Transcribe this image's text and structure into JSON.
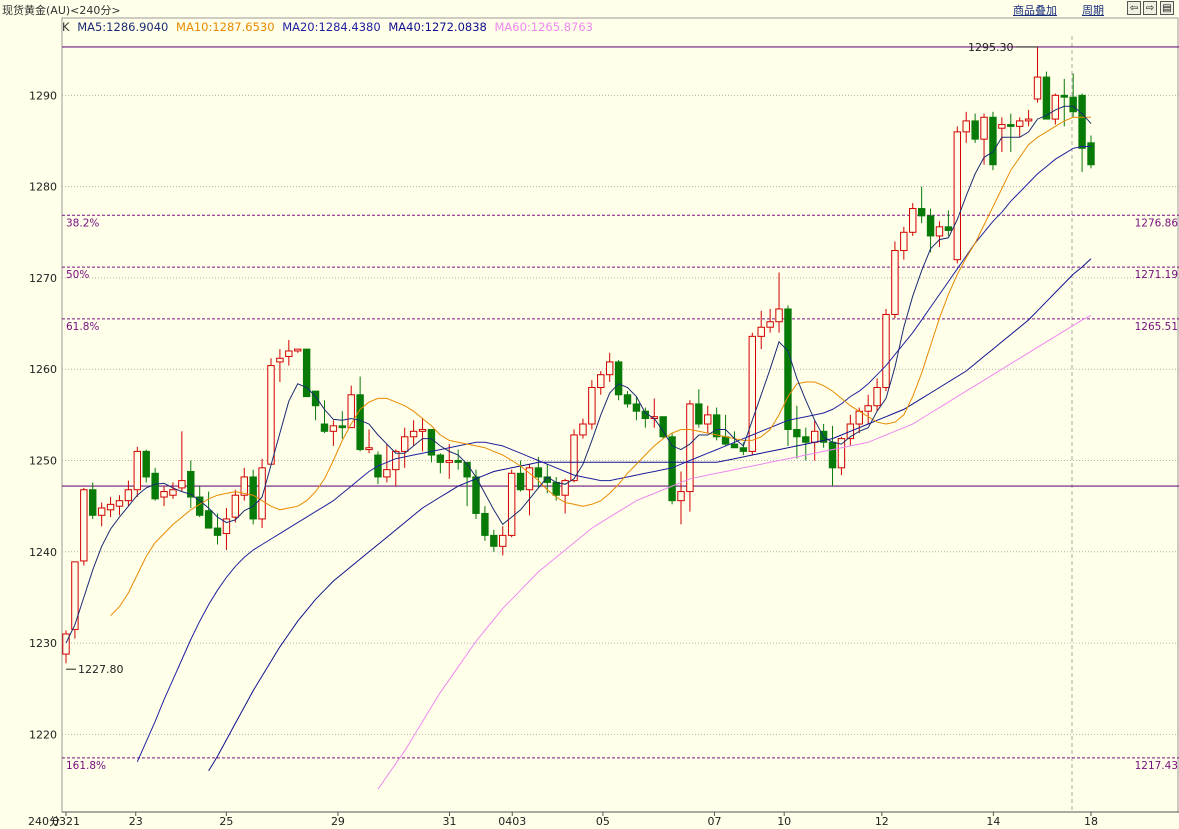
{
  "header": {
    "title": "现货黄金(AU)<240分>",
    "overlay_btn": "商品叠加",
    "period_btn": "周期",
    "nav_prev_icon": "arrow-left-box",
    "nav_next_icon": "arrow-right-box",
    "panel_icon": "panel-layout"
  },
  "ma_legend": {
    "k": "K",
    "ma5": "MA5:1286.9040",
    "ma10": "MA10:1287.6530",
    "ma20": "MA20:1284.4380",
    "ma40": "MA40:1272.0838",
    "ma60": "MA60:1265.8763"
  },
  "colors": {
    "up": "#d20000",
    "down": "#087a08",
    "ma5": "#1a2b72",
    "ma10": "#e88a00",
    "ma20": "#2020a0",
    "ma40": "#101090",
    "ma60": "#ee88ee",
    "fib": "#7a1080",
    "bg": "#ffffea",
    "grid": "#b0b0b0"
  },
  "chart_data": {
    "type": "candlestick",
    "period_label": "240分",
    "x_tick_labels": [
      "0321",
      "23",
      "25",
      "29",
      "31",
      "0403",
      "05",
      "07",
      "10",
      "12",
      "14",
      "18"
    ],
    "y_ticks": [
      1220,
      1230,
      1240,
      1250,
      1260,
      1270,
      1280,
      1290
    ],
    "ylim": [
      1211.5,
      1296.5
    ],
    "max_label": "1295.30",
    "min_label": "1227.80",
    "fib_levels": [
      {
        "pct": "38.2%",
        "value": "1276.86"
      },
      {
        "pct": "50%",
        "value": "1271.19"
      },
      {
        "pct": "61.8%",
        "value": "1265.51"
      },
      {
        "pct": "161.8%",
        "value": "1217.43"
      }
    ],
    "hlines": [
      1295.3,
      1247.2
    ],
    "candles": [
      [
        1228.8,
        1231.4,
        1227.8,
        1231.0
      ],
      [
        1231.5,
        1238.9,
        1230.5,
        1238.9
      ],
      [
        1239.0,
        1247.0,
        1238.5,
        1246.8
      ],
      [
        1246.8,
        1247.6,
        1243.6,
        1244.0
      ],
      [
        1244.0,
        1245.4,
        1242.8,
        1244.8
      ],
      [
        1244.6,
        1246.0,
        1243.8,
        1245.2
      ],
      [
        1245.0,
        1246.2,
        1244.0,
        1245.6
      ],
      [
        1245.6,
        1247.8,
        1245.0,
        1246.8
      ],
      [
        1246.8,
        1251.5,
        1246.0,
        1251.0
      ],
      [
        1251.0,
        1251.2,
        1247.6,
        1248.2
      ],
      [
        1248.6,
        1249.2,
        1245.6,
        1245.8
      ],
      [
        1246.0,
        1247.2,
        1245.0,
        1246.6
      ],
      [
        1246.2,
        1247.6,
        1245.8,
        1246.8
      ],
      [
        1247.0,
        1253.2,
        1246.6,
        1247.8
      ],
      [
        1248.8,
        1250.0,
        1244.8,
        1246.0
      ],
      [
        1246.0,
        1247.2,
        1243.8,
        1244.0
      ],
      [
        1244.5,
        1246.6,
        1243.0,
        1242.6
      ],
      [
        1242.6,
        1244.2,
        1240.8,
        1241.8
      ],
      [
        1242.0,
        1244.8,
        1240.2,
        1243.6
      ],
      [
        1243.8,
        1246.8,
        1243.2,
        1246.2
      ],
      [
        1246.2,
        1249.2,
        1245.6,
        1248.2
      ],
      [
        1248.2,
        1249.0,
        1243.0,
        1243.6
      ],
      [
        1243.6,
        1250.2,
        1242.6,
        1249.2
      ],
      [
        1249.6,
        1261.2,
        1249.6,
        1260.4
      ],
      [
        1260.8,
        1262.2,
        1258.6,
        1261.2
      ],
      [
        1261.4,
        1263.2,
        1260.4,
        1262.0
      ],
      [
        1262.0,
        1261.0,
        1261.8,
        1262.2
      ],
      [
        1262.2,
        1261.2,
        1257.0,
        1257.0
      ],
      [
        1257.6,
        1257.4,
        1254.4,
        1256.0
      ],
      [
        1254.0,
        1256.6,
        1253.0,
        1253.2
      ],
      [
        1253.2,
        1254.4,
        1251.6,
        1253.8
      ],
      [
        1253.8,
        1255.4,
        1252.4,
        1253.6
      ],
      [
        1253.6,
        1258.2,
        1253.6,
        1257.2
      ],
      [
        1257.2,
        1259.2,
        1251.0,
        1251.2
      ],
      [
        1251.2,
        1253.4,
        1250.8,
        1251.4
      ],
      [
        1250.6,
        1251.0,
        1247.4,
        1248.2
      ],
      [
        1248.2,
        1251.8,
        1247.6,
        1249.0
      ],
      [
        1249.0,
        1251.2,
        1247.2,
        1251.0
      ],
      [
        1251.0,
        1253.6,
        1249.2,
        1252.6
      ],
      [
        1252.6,
        1254.4,
        1251.6,
        1253.2
      ],
      [
        1253.2,
        1254.6,
        1251.0,
        1253.4
      ],
      [
        1253.4,
        1253.4,
        1249.8,
        1250.6
      ],
      [
        1250.6,
        1250.8,
        1248.6,
        1249.8
      ],
      [
        1249.8,
        1251.8,
        1248.0,
        1250.0
      ],
      [
        1250.0,
        1251.2,
        1249.0,
        1249.8
      ],
      [
        1249.8,
        1249.8,
        1245.0,
        1248.2
      ],
      [
        1248.2,
        1249.0,
        1243.6,
        1244.2
      ],
      [
        1244.2,
        1245.0,
        1241.2,
        1241.8
      ],
      [
        1241.8,
        1242.4,
        1240.0,
        1240.6
      ],
      [
        1240.6,
        1242.8,
        1239.6,
        1241.8
      ],
      [
        1241.8,
        1249.0,
        1241.6,
        1248.6
      ],
      [
        1248.6,
        1250.0,
        1246.6,
        1246.8
      ],
      [
        1246.8,
        1249.6,
        1244.0,
        1249.2
      ],
      [
        1249.2,
        1250.4,
        1247.0,
        1248.2
      ],
      [
        1248.2,
        1249.6,
        1246.4,
        1247.6
      ],
      [
        1247.6,
        1248.2,
        1245.6,
        1246.2
      ],
      [
        1246.2,
        1248.0,
        1244.2,
        1247.8
      ],
      [
        1247.8,
        1253.4,
        1247.6,
        1252.8
      ],
      [
        1252.8,
        1254.6,
        1252.4,
        1254.0
      ],
      [
        1254.0,
        1258.8,
        1253.4,
        1258.0
      ],
      [
        1258.0,
        1259.8,
        1257.2,
        1259.4
      ],
      [
        1259.4,
        1261.8,
        1258.6,
        1260.8
      ],
      [
        1260.8,
        1261.0,
        1256.6,
        1257.2
      ],
      [
        1257.2,
        1257.6,
        1255.8,
        1256.2
      ],
      [
        1256.2,
        1257.0,
        1254.4,
        1255.4
      ],
      [
        1255.4,
        1255.8,
        1253.6,
        1254.6
      ],
      [
        1254.6,
        1256.8,
        1253.6,
        1254.8
      ],
      [
        1254.8,
        1254.8,
        1252.4,
        1252.6
      ],
      [
        1252.6,
        1253.0,
        1245.2,
        1245.6
      ],
      [
        1245.6,
        1248.8,
        1243.0,
        1246.6
      ],
      [
        1246.6,
        1256.6,
        1244.4,
        1256.2
      ],
      [
        1256.2,
        1257.8,
        1253.6,
        1254.0
      ],
      [
        1254.0,
        1256.0,
        1253.0,
        1255.0
      ],
      [
        1255.0,
        1255.8,
        1252.2,
        1252.6
      ],
      [
        1252.6,
        1255.0,
        1251.6,
        1251.8
      ],
      [
        1251.8,
        1253.2,
        1251.4,
        1251.4
      ],
      [
        1251.4,
        1252.0,
        1250.6,
        1251.0
      ],
      [
        1251.0,
        1264.0,
        1250.6,
        1263.6
      ],
      [
        1263.6,
        1266.4,
        1262.2,
        1264.6
      ],
      [
        1264.6,
        1266.6,
        1264.0,
        1265.2
      ],
      [
        1265.2,
        1270.6,
        1264.0,
        1266.6
      ],
      [
        1266.6,
        1267.0,
        1251.6,
        1253.4
      ],
      [
        1253.4,
        1256.0,
        1250.2,
        1252.6
      ],
      [
        1252.6,
        1253.6,
        1250.0,
        1252.0
      ],
      [
        1252.0,
        1254.4,
        1250.0,
        1253.2
      ],
      [
        1253.2,
        1254.0,
        1251.4,
        1252.0
      ],
      [
        1252.0,
        1253.8,
        1247.2,
        1249.2
      ],
      [
        1249.2,
        1252.6,
        1248.4,
        1252.4
      ],
      [
        1252.4,
        1255.0,
        1251.6,
        1254.0
      ],
      [
        1254.0,
        1255.8,
        1253.0,
        1255.4
      ],
      [
        1255.4,
        1257.2,
        1254.0,
        1256.0
      ],
      [
        1256.0,
        1259.0,
        1255.4,
        1258.0
      ],
      [
        1258.0,
        1266.6,
        1257.6,
        1266.0
      ],
      [
        1266.0,
        1274.0,
        1265.6,
        1273.0
      ],
      [
        1273.0,
        1275.6,
        1272.0,
        1275.0
      ],
      [
        1275.0,
        1278.2,
        1274.6,
        1277.6
      ],
      [
        1277.6,
        1280.0,
        1276.0,
        1276.8
      ],
      [
        1276.8,
        1277.6,
        1272.8,
        1274.6
      ],
      [
        1274.6,
        1276.2,
        1273.4,
        1275.6
      ],
      [
        1275.6,
        1277.4,
        1274.6,
        1275.2
      ],
      [
        1272.0,
        1286.6,
        1271.6,
        1286.0
      ],
      [
        1286.0,
        1288.2,
        1284.8,
        1287.2
      ],
      [
        1287.2,
        1288.0,
        1284.8,
        1285.2
      ],
      [
        1285.2,
        1288.0,
        1282.4,
        1287.6
      ],
      [
        1287.6,
        1288.2,
        1281.8,
        1282.4
      ],
      [
        1286.4,
        1287.6,
        1283.8,
        1286.8
      ],
      [
        1286.8,
        1288.0,
        1283.8,
        1286.6
      ],
      [
        1286.6,
        1287.6,
        1285.4,
        1287.2
      ],
      [
        1287.2,
        1288.4,
        1286.6,
        1287.4
      ],
      [
        1289.6,
        1295.3,
        1289.2,
        1292.0
      ],
      [
        1292.0,
        1292.6,
        1287.8,
        1287.4
      ],
      [
        1287.4,
        1290.2,
        1286.8,
        1290.0
      ],
      [
        1290.0,
        1291.8,
        1286.6,
        1289.8
      ],
      [
        1289.8,
        1292.4,
        1287.6,
        1288.2
      ],
      [
        1290.0,
        1290.2,
        1281.6,
        1284.2
      ],
      [
        1284.8,
        1285.6,
        1282.0,
        1282.4
      ]
    ],
    "ma_series": {
      "ma5": [
        1230.0,
        1232.0,
        1235.0,
        1238.0,
        1240.6,
        1242.5,
        1243.8,
        1245.0,
        1246.2,
        1247.0,
        1247.4,
        1247.5,
        1247.0,
        1246.6,
        1246.3,
        1245.6,
        1244.8,
        1243.8,
        1243.2,
        1243.5,
        1244.5,
        1245.0,
        1246.0,
        1249.5,
        1253.0,
        1256.5,
        1258.4,
        1258.0,
        1257.0,
        1255.6,
        1254.5,
        1254.4,
        1254.6,
        1254.4,
        1254.0,
        1252.8,
        1251.8,
        1250.8,
        1250.8,
        1251.6,
        1252.4,
        1252.4,
        1251.6,
        1251.0,
        1250.6,
        1249.6,
        1248.2,
        1246.4,
        1244.6,
        1243.0,
        1243.8,
        1244.6,
        1245.8,
        1247.0,
        1248.2,
        1247.6,
        1247.4,
        1248.0,
        1249.6,
        1252.2,
        1255.0,
        1257.4,
        1258.4,
        1258.0,
        1257.0,
        1255.2,
        1254.6,
        1253.2,
        1251.6,
        1251.2,
        1251.8,
        1252.8,
        1252.8,
        1253.4,
        1253.4,
        1252.4,
        1251.6,
        1254.4,
        1257.2,
        1260.0,
        1263.0,
        1262.0,
        1259.0,
        1256.6,
        1254.4,
        1252.6,
        1252.0,
        1251.8,
        1252.6,
        1253.2,
        1253.6,
        1255.4,
        1256.8,
        1260.2,
        1264.6,
        1268.0,
        1270.8,
        1273.2,
        1274.2,
        1274.4,
        1276.4,
        1279.0,
        1281.4,
        1283.2,
        1283.8,
        1285.4,
        1285.4,
        1285.4,
        1286.0,
        1287.4,
        1287.8,
        1288.4,
        1288.8,
        1288.8,
        1288.0,
        1286.9
      ],
      "ma10": [
        1233.0,
        1234.0,
        1235.5,
        1237.5,
        1239.5,
        1241.0,
        1242.0,
        1243.0,
        1243.8,
        1244.6,
        1245.2,
        1245.8,
        1246.2,
        1246.4,
        1246.6,
        1246.4,
        1246.2,
        1245.6,
        1245.0,
        1244.6,
        1244.8,
        1245.0,
        1245.6,
        1246.6,
        1248.0,
        1250.0,
        1252.2,
        1254.0,
        1255.6,
        1256.4,
        1256.8,
        1256.8,
        1256.4,
        1256.0,
        1255.4,
        1254.6,
        1253.8,
        1252.8,
        1252.2,
        1252.0,
        1251.8,
        1251.6,
        1251.4,
        1251.0,
        1250.6,
        1250.0,
        1249.4,
        1248.6,
        1247.8,
        1246.8,
        1246.0,
        1245.4,
        1245.2,
        1245.0,
        1245.2,
        1245.6,
        1246.4,
        1247.4,
        1248.6,
        1249.6,
        1250.6,
        1251.6,
        1252.4,
        1253.0,
        1253.4,
        1253.4,
        1253.2,
        1253.0,
        1252.8,
        1252.6,
        1252.4,
        1252.2,
        1252.2,
        1252.6,
        1253.4,
        1255.0,
        1257.0,
        1258.4,
        1258.6,
        1258.6,
        1258.2,
        1257.6,
        1256.8,
        1256.0,
        1255.4,
        1254.8,
        1254.2,
        1254.0,
        1254.2,
        1255.0,
        1257.0,
        1259.6,
        1262.6,
        1265.6,
        1268.2,
        1270.4,
        1272.2,
        1273.8,
        1275.8,
        1277.8,
        1279.8,
        1281.8,
        1283.2,
        1284.6,
        1285.4,
        1286.0,
        1286.6,
        1287.2,
        1287.6,
        1287.6,
        1287.6
      ],
      "ma20": [
        1217.0,
        1219.2,
        1221.4,
        1223.8,
        1226.0,
        1228.2,
        1230.4,
        1232.4,
        1234.2,
        1235.8,
        1237.2,
        1238.4,
        1239.4,
        1240.2,
        1240.8,
        1241.4,
        1242.0,
        1242.6,
        1243.2,
        1243.8,
        1244.4,
        1245.0,
        1245.6,
        1246.4,
        1247.2,
        1248.0,
        1248.8,
        1249.4,
        1249.8,
        1250.2,
        1250.4,
        1250.6,
        1250.8,
        1251.0,
        1251.2,
        1251.4,
        1251.6,
        1251.8,
        1252.0,
        1252.0,
        1251.8,
        1251.6,
        1251.2,
        1250.8,
        1250.4,
        1250.0,
        1249.6,
        1249.2,
        1248.8,
        1248.4,
        1248.2,
        1248.0,
        1247.8,
        1247.8,
        1248.0,
        1248.2,
        1248.4,
        1248.6,
        1248.8,
        1249.0,
        1249.2,
        1249.6,
        1250.0,
        1250.4,
        1250.8,
        1251.2,
        1251.6,
        1252.0,
        1252.4,
        1252.8,
        1253.2,
        1253.6,
        1254.0,
        1254.4,
        1254.6,
        1254.8,
        1255.0,
        1255.2,
        1255.6,
        1256.2,
        1257.0,
        1257.6,
        1258.4,
        1259.4,
        1260.4,
        1261.6,
        1262.8,
        1264.0,
        1265.4,
        1266.8,
        1268.2,
        1269.6,
        1271.0,
        1272.4,
        1273.8,
        1275.0,
        1276.2,
        1277.2,
        1278.4,
        1279.4,
        1280.4,
        1281.4,
        1282.2,
        1283.0,
        1283.6,
        1284.2,
        1284.4,
        1284.4
      ],
      "ma40": [
        1216.0,
        1217.6,
        1219.4,
        1221.2,
        1223.0,
        1224.8,
        1226.4,
        1228.0,
        1229.6,
        1231.0,
        1232.4,
        1233.6,
        1234.8,
        1235.8,
        1236.8,
        1237.6,
        1238.4,
        1239.2,
        1240.0,
        1240.8,
        1241.6,
        1242.4,
        1243.2,
        1244.0,
        1244.8,
        1245.4,
        1246.0,
        1246.6,
        1247.2,
        1247.6,
        1248.0,
        1248.4,
        1248.8,
        1249.0,
        1249.2,
        1249.4,
        1249.6,
        1249.8,
        1249.8,
        1249.8,
        1249.8,
        1249.8,
        1249.8,
        1249.8,
        1249.8,
        1249.8,
        1249.8,
        1249.8,
        1249.8,
        1249.8,
        1249.8,
        1249.8,
        1249.8,
        1249.8,
        1249.8,
        1249.8,
        1249.8,
        1249.8,
        1250.0,
        1250.2,
        1250.4,
        1250.6,
        1250.8,
        1251.0,
        1251.2,
        1251.4,
        1251.6,
        1251.8,
        1252.0,
        1252.2,
        1252.4,
        1252.8,
        1253.2,
        1253.6,
        1254.0,
        1254.4,
        1254.8,
        1255.2,
        1255.6,
        1256.2,
        1256.8,
        1257.4,
        1258.0,
        1258.6,
        1259.2,
        1259.8,
        1260.6,
        1261.4,
        1262.2,
        1263.0,
        1263.8,
        1264.6,
        1265.4,
        1266.4,
        1267.4,
        1268.4,
        1269.4,
        1270.4,
        1271.2,
        1272.1
      ],
      "ma60": [
        1214.0,
        1215.4,
        1216.8,
        1218.2,
        1219.8,
        1221.4,
        1223.0,
        1224.6,
        1226.0,
        1227.4,
        1228.8,
        1230.2,
        1231.4,
        1232.6,
        1233.8,
        1234.8,
        1235.8,
        1236.8,
        1237.8,
        1238.6,
        1239.4,
        1240.2,
        1241.0,
        1241.8,
        1242.6,
        1243.2,
        1243.8,
        1244.4,
        1245.0,
        1245.6,
        1246.0,
        1246.4,
        1246.8,
        1247.2,
        1247.6,
        1248.0,
        1248.2,
        1248.4,
        1248.6,
        1248.8,
        1249.0,
        1249.2,
        1249.4,
        1249.6,
        1249.8,
        1250.0,
        1250.2,
        1250.4,
        1250.6,
        1250.8,
        1251.0,
        1251.2,
        1251.4,
        1251.6,
        1251.8,
        1252.0,
        1252.4,
        1252.8,
        1253.2,
        1253.6,
        1254.0,
        1254.6,
        1255.2,
        1255.8,
        1256.4,
        1257.0,
        1257.6,
        1258.2,
        1258.8,
        1259.4,
        1260.0,
        1260.6,
        1261.2,
        1261.8,
        1262.4,
        1263.0,
        1263.6,
        1264.2,
        1264.8,
        1265.4,
        1265.9
      ]
    }
  }
}
